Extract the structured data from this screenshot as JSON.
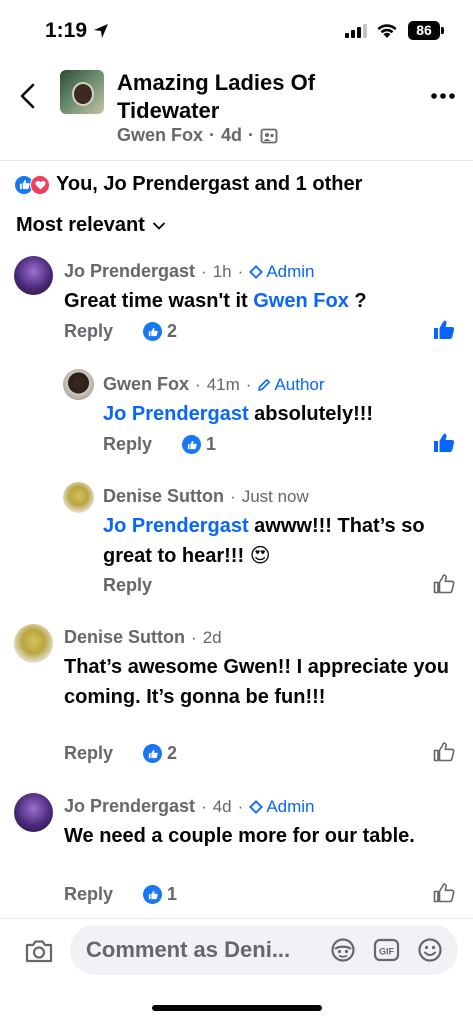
{
  "status_bar": {
    "time": "1:19",
    "battery": "86"
  },
  "header": {
    "group_title": "Amazing Ladies Of Tidewater",
    "author": "Gwen Fox",
    "age": "4d",
    "sep": "·"
  },
  "reactions": {
    "summary": "You, Jo Prendergast and 1 other"
  },
  "sort": {
    "label": "Most relevant"
  },
  "comments": [
    {
      "name": "Jo Prendergast",
      "time": "1h",
      "badge": "Admin",
      "text": "Great time wasn't it ",
      "mention": "Gwen Fox",
      "text_after": " ?",
      "reply": "Reply",
      "likes": "2"
    },
    {
      "name": "Gwen Fox",
      "time": "41m",
      "badge": "Author",
      "mention": "Jo Prendergast",
      "text": " absolutely!!!",
      "reply": "Reply",
      "likes": "1"
    },
    {
      "name": "Denise Sutton",
      "time": "Just now",
      "mention": "Jo Prendergast",
      "text": " awww!!! That’s so great to hear!!! ",
      "emoji": "😍",
      "reply": "Reply"
    },
    {
      "name": "Denise Sutton",
      "time": "2d",
      "text": "That’s awesome Gwen!! I appreciate you coming. It’s gonna be fun!!!",
      "reply": "Reply",
      "likes": "2"
    },
    {
      "name": "Jo Prendergast",
      "time": "4d",
      "badge": "Admin",
      "text": "We need a couple more for our table.",
      "reply": "Reply",
      "likes": "1"
    }
  ],
  "composer": {
    "placeholder": "Comment as Deni..."
  },
  "icons": {
    "like_color": "#1877f2",
    "love_color": "#f33e58",
    "mention_color": "#0866ff",
    "meta_color": "#65676b"
  }
}
